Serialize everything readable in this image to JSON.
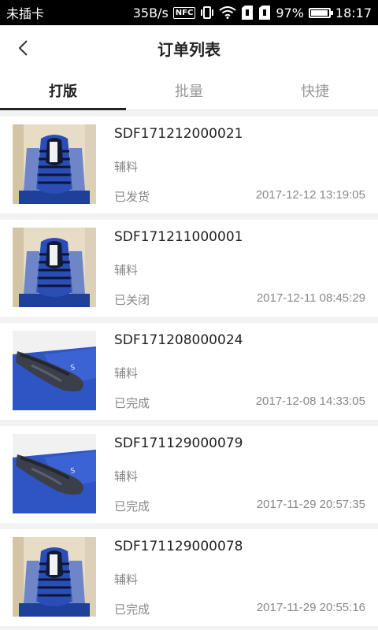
{
  "status_bar": {
    "carrier": "未插卡",
    "speed": "35B/s",
    "nfc": "NFC",
    "battery": "97%",
    "battery_level": 0.97,
    "time": "18:17"
  },
  "header": {
    "title": "订单列表"
  },
  "tabs": [
    {
      "label": "打版",
      "active": true
    },
    {
      "label": "批量",
      "active": false
    },
    {
      "label": "快捷",
      "active": false
    }
  ],
  "orders": [
    {
      "order_no": "SDF171212000021",
      "category": "辅料",
      "status": "已发货",
      "time": "2017-12-12 13:19:05",
      "thumb": "upright-shoe"
    },
    {
      "order_no": "SDF171211000001",
      "category": "辅料",
      "status": "已关闭",
      "time": "2017-12-11 08:45:29",
      "thumb": "upright-shoe"
    },
    {
      "order_no": "SDF171208000024",
      "category": "辅料",
      "status": "已完成",
      "time": "2017-12-08 14:33:05",
      "thumb": "flat-shoe"
    },
    {
      "order_no": "SDF171129000079",
      "category": "辅料",
      "status": "已完成",
      "time": "2017-11-29 20:57:35",
      "thumb": "flat-shoe"
    },
    {
      "order_no": "SDF171129000078",
      "category": "辅料",
      "status": "已完成",
      "time": "2017-11-29 20:55:16",
      "thumb": "upright-shoe"
    }
  ]
}
